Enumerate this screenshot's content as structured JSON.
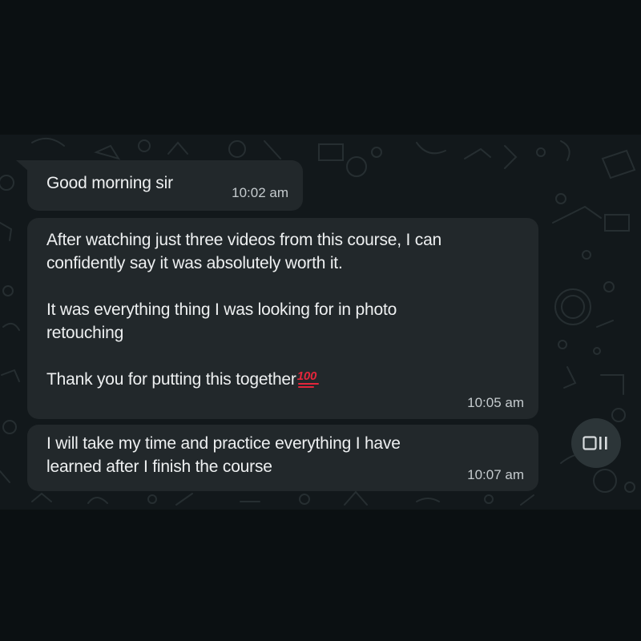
{
  "messages": [
    {
      "text": "Good morning sir",
      "time": "10:02 am"
    },
    {
      "text": "After watching just three videos from this course, I can\nconfidently say it was absolutely worth it.\n\nIt was everything thing I was looking for in photo\nretouching\n\nThank you for putting this together",
      "emoji": "💯",
      "emoji_name": "hundred-points",
      "time": "10:05 am"
    },
    {
      "text": "I will take my time and practice everything I have\nlearned after I finish the course",
      "time": "10:07 am"
    }
  ],
  "side_button": {
    "icon": "media-toggle-icon"
  },
  "colors": {
    "page_bg": "#0b1012",
    "chat_bg": "#12181b",
    "bubble_bg": "#22282b",
    "text": "#eef0f1",
    "time": "#c5cbce",
    "emoji_red": "#e3263b"
  }
}
